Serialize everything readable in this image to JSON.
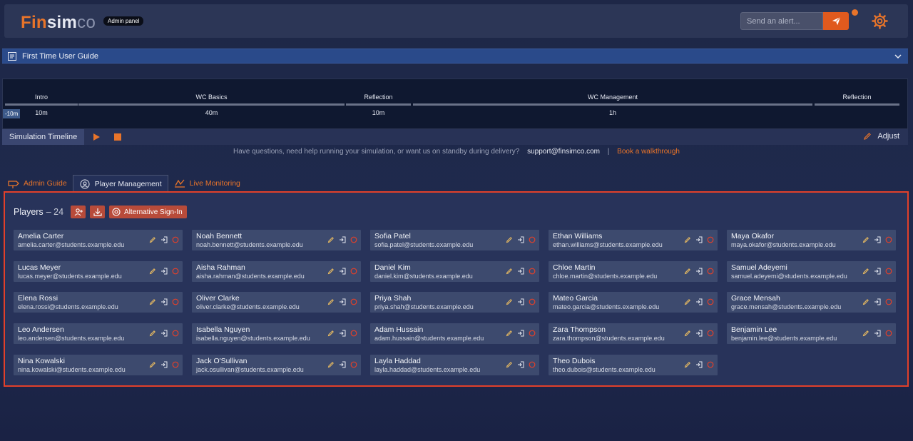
{
  "header": {
    "logo_fin": "Fin",
    "logo_sim": "sim",
    "logo_co": "co",
    "badge": "Admin panel",
    "alert_placeholder": "Send an alert..."
  },
  "guide": {
    "title": "First Time User Guide"
  },
  "timeline": {
    "segments": [
      {
        "name": "Intro",
        "duration": "10m"
      },
      {
        "name": "WC Basics",
        "duration": "40m"
      },
      {
        "name": "Reflection",
        "duration": "10m"
      },
      {
        "name": "WC Management",
        "duration": "1h"
      },
      {
        "name": "Reflection",
        "duration": ""
      }
    ],
    "offset_badge": "-10m",
    "label": "Simulation Timeline",
    "adjust": "Adjust"
  },
  "help": {
    "question": "Have questions, need help running your simulation, or want us on standby during delivery?",
    "email": "support@finsimco.com",
    "separator": "|",
    "walkthrough": "Book a walkthrough"
  },
  "tabs": [
    {
      "label": "Admin Guide"
    },
    {
      "label": "Player Management"
    },
    {
      "label": "Live Monitoring"
    }
  ],
  "players": {
    "title": "Players",
    "count": "– 24",
    "alt_signin": "Alternative Sign-In",
    "list": [
      {
        "name": "Amelia Carter",
        "email": "amelia.carter@students.example.edu"
      },
      {
        "name": "Noah Bennett",
        "email": "noah.bennett@students.example.edu"
      },
      {
        "name": "Sofia Patel",
        "email": "sofia.patel@students.example.edu"
      },
      {
        "name": "Ethan Williams",
        "email": "ethan.williams@students.example.edu"
      },
      {
        "name": "Maya Okafor",
        "email": "maya.okafor@students.example.edu"
      },
      {
        "name": "Lucas Meyer",
        "email": "lucas.meyer@students.example.edu"
      },
      {
        "name": "Aisha Rahman",
        "email": "aisha.rahman@students.example.edu"
      },
      {
        "name": "Daniel Kim",
        "email": "daniel.kim@students.example.edu"
      },
      {
        "name": "Chloe Martin",
        "email": "chloe.martin@students.example.edu"
      },
      {
        "name": "Samuel Adeyemi",
        "email": "samuel.adeyemi@students.example.edu"
      },
      {
        "name": "Elena Rossi",
        "email": "elena.rossi@students.example.edu"
      },
      {
        "name": "Oliver Clarke",
        "email": "oliver.clarke@students.example.edu"
      },
      {
        "name": "Priya Shah",
        "email": "priya.shah@students.example.edu"
      },
      {
        "name": "Mateo Garcia",
        "email": "mateo.garcia@students.example.edu"
      },
      {
        "name": "Grace Mensah",
        "email": "grace.mensah@students.example.edu"
      },
      {
        "name": "Leo Andersen",
        "email": "leo.andersen@students.example.edu"
      },
      {
        "name": "Isabella Nguyen",
        "email": "isabella.nguyen@students.example.edu"
      },
      {
        "name": "Adam Hussain",
        "email": "adam.hussain@students.example.edu"
      },
      {
        "name": "Zara Thompson",
        "email": "zara.thompson@students.example.edu"
      },
      {
        "name": "Benjamin Lee",
        "email": "benjamin.lee@students.example.edu"
      },
      {
        "name": "Nina Kowalski",
        "email": "nina.kowalski@students.example.edu"
      },
      {
        "name": "Jack O'Sullivan",
        "email": "jack.osullivan@students.example.edu"
      },
      {
        "name": "Layla Haddad",
        "email": "layla.haddad@students.example.edu"
      },
      {
        "name": "Theo Dubois",
        "email": "theo.dubois@students.example.edu"
      }
    ]
  },
  "colors": {
    "accent": "#e8742a",
    "highlight_border": "#e2402a",
    "card": "#3d4a6e"
  }
}
